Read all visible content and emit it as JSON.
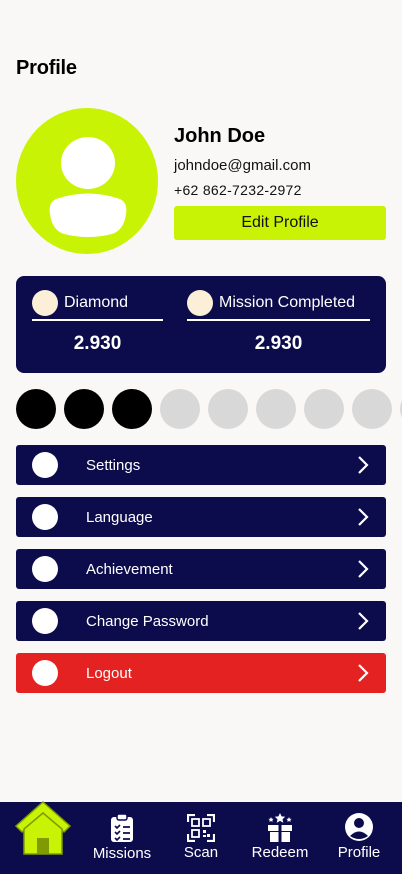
{
  "page": {
    "title": "Profile"
  },
  "user": {
    "name": "John Doe",
    "email": "johndoe@gmail.com",
    "phone": "+62 862-7232-2972",
    "edit_label": "Edit Profile"
  },
  "stats": [
    {
      "label": "Diamond",
      "value": "2.930"
    },
    {
      "label": "Mission Completed",
      "value": "2.930"
    }
  ],
  "progress_dots": {
    "filled": 3,
    "visible": 9
  },
  "menu": [
    {
      "label": "Settings"
    },
    {
      "label": "Language"
    },
    {
      "label": "Achievement"
    },
    {
      "label": "Change Password"
    },
    {
      "label": "Logout"
    }
  ],
  "nav": [
    {
      "label": "",
      "icon": "home-icon"
    },
    {
      "label": "Missions",
      "icon": "clipboard-icon"
    },
    {
      "label": "Scan",
      "icon": "qr-code-icon"
    },
    {
      "label": "Redeem",
      "icon": "gift-icon"
    },
    {
      "label": "Profile",
      "icon": "user-circle-icon"
    }
  ],
  "colors": {
    "accent": "#c8f304",
    "navy": "#0c0c4c",
    "danger": "#e52222",
    "background": "#f9f8f6"
  }
}
